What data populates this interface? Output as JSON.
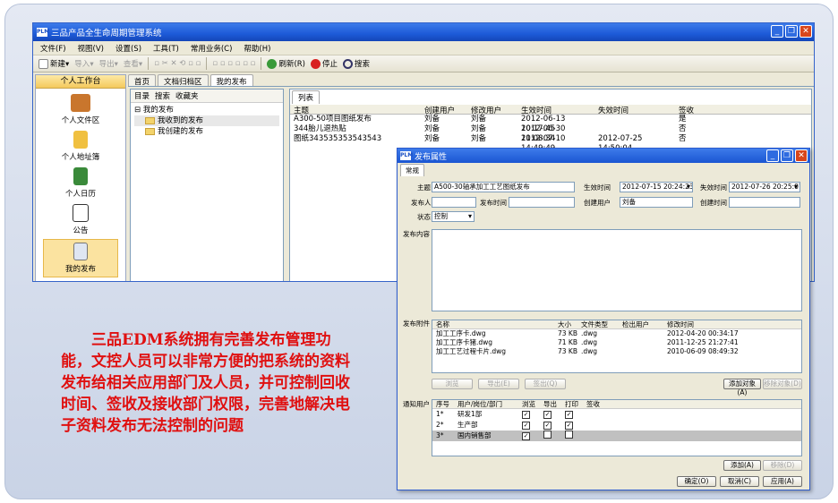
{
  "window": {
    "title": "三品产品全生命周期管理系统",
    "logo": "PLM"
  },
  "menu": [
    "文件(F)",
    "视图(V)",
    "设置(S)",
    "工具(T)",
    "常用业务(C)",
    "帮助(H)"
  ],
  "toolbar": {
    "new": "新建",
    "import": "导入",
    "export": "导出",
    "view": "查看",
    "refresh": "刷新(R)",
    "stop": "停止",
    "search": "搜索"
  },
  "left_panel": {
    "header": "个人工作台",
    "items": [
      "个人文件区",
      "个人地址簿",
      "个人日历",
      "公告",
      "我的发布"
    ]
  },
  "top_tabs": [
    "首页",
    "文档归档区",
    "我的发布"
  ],
  "tree_tabs": [
    "目录",
    "搜索",
    "收藏夹"
  ],
  "tree": {
    "root": "我的发布",
    "children": [
      "我收到的发布",
      "我创建的发布"
    ]
  },
  "list": {
    "tab": "列表",
    "headers": [
      "主题",
      "创建用户",
      "修改用户",
      "生效时间",
      "失效时间",
      "签收"
    ],
    "rows": [
      [
        "A300-50项目图纸发布",
        "刘备",
        "刘备",
        "2012-06-13 10:17:45",
        "",
        "是"
      ],
      [
        "344胎儿退热贴",
        "刘备",
        "刘备",
        "2012-06-30 11:08:34",
        "",
        "否"
      ],
      [
        "图纸343535353543543",
        "刘备",
        "刘备",
        "2012-07-10 14:49:49",
        "2012-07-25 14:50:04",
        "否"
      ]
    ]
  },
  "dialog": {
    "title": "发布属性",
    "tab": "常规",
    "subject_label": "主题",
    "subject": "A500-30轴承加工工艺图纸发布",
    "effective_label": "生效时间",
    "effective": "2012-07-15 20:24:23",
    "expire_label": "失效时间",
    "expire": "2012-07-26 20:25:07",
    "publisher_label": "发布人",
    "publish_time_label": "发布时间",
    "creator_label": "创建用户",
    "creator": "刘备",
    "create_time_label": "创建时间",
    "status_label": "状态",
    "status": "控制",
    "content_label": "发布内容",
    "attach_label": "发布附件",
    "attach_headers": [
      "名称",
      "大小",
      "文件类型",
      "检出用户",
      "修改时间"
    ],
    "attachments": [
      [
        "加工工序卡.dwg",
        "73 KB",
        ".dwg",
        "",
        "2012-04-20 00:34:17"
      ],
      [
        "加工工序卡猪.dwg",
        "71 KB",
        ".dwg",
        "",
        "2011-12-25 21:27:41"
      ],
      [
        "加工工艺过程卡片.dwg",
        "73 KB",
        ".dwg",
        "",
        "2010-06-09 08:49:32"
      ]
    ],
    "attach_buttons": [
      "浏览",
      "导出(E)",
      "签出(Q)"
    ],
    "add_object": "添加对象(A)",
    "remove_object": "移除对象(D)",
    "notify_label": "通知用户",
    "notify_headers": [
      "序号",
      "用户/岗位/部门",
      "浏览",
      "导出",
      "打印",
      "签收"
    ],
    "notify": [
      [
        "1*",
        "研发1部",
        true,
        true,
        true
      ],
      [
        "2*",
        "生产部",
        true,
        true,
        true
      ],
      [
        "3*",
        "国内销售部",
        true,
        false,
        false
      ]
    ],
    "add": "添加(A)",
    "remove": "移除(D)",
    "ok": "确定(O)",
    "cancel": "取消(C)",
    "apply": "应用(A)"
  },
  "caption": "三品EDM系统拥有完善发布管理功能，文控人员可以非常方便的把系统的资料发布给相关应用部门及人员，并可控制回收时间、签收及接收部门权限，完善地解决电子资料发布无法控制的问题",
  "colors": {
    "caption": "#e01010",
    "titlebar": "#1d5ad8"
  }
}
